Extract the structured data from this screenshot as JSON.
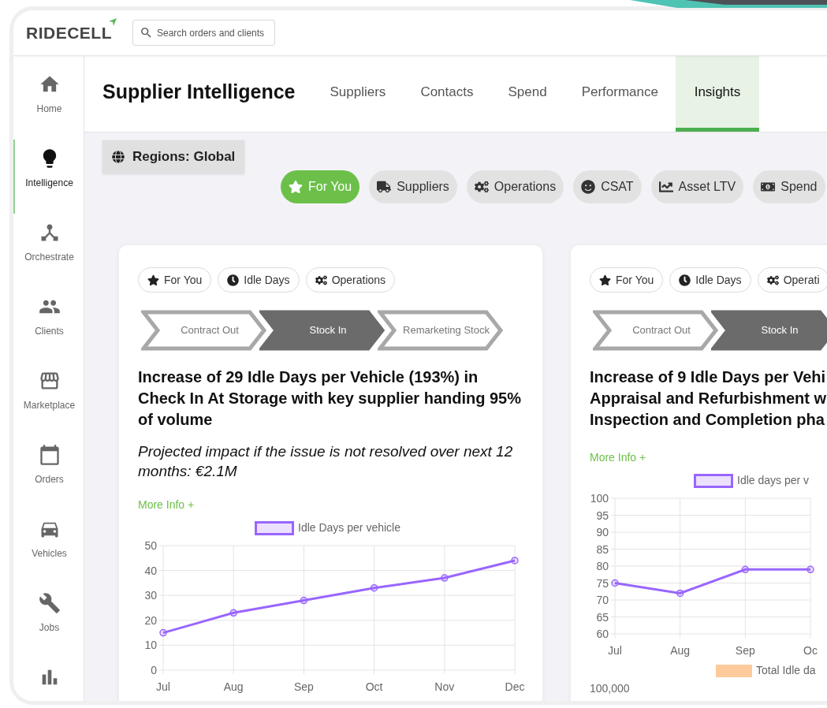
{
  "header": {
    "logo": "RIDECELL",
    "search": {
      "placeholder": "Search orders and clients"
    }
  },
  "sidebar": {
    "items": [
      {
        "label": "Home",
        "selected": false
      },
      {
        "label": "Intelligence",
        "selected": true
      },
      {
        "label": "Orchestrate",
        "selected": false
      },
      {
        "label": "Clients",
        "selected": false
      },
      {
        "label": "Marketplace",
        "selected": false
      },
      {
        "label": "Orders",
        "selected": false
      },
      {
        "label": "Vehicles",
        "selected": false
      },
      {
        "label": "Jobs",
        "selected": false
      },
      {
        "selected": false
      }
    ]
  },
  "page": {
    "title": "Supplier Intelligence",
    "tabs": [
      {
        "label": "Suppliers",
        "selected": false
      },
      {
        "label": "Contacts",
        "selected": false
      },
      {
        "label": "Spend",
        "selected": false
      },
      {
        "label": "Performance",
        "selected": false
      },
      {
        "label": "Insights",
        "selected": true
      }
    ]
  },
  "region_button": "Regions: Global",
  "filters": [
    {
      "label": "For You",
      "selected": true
    },
    {
      "label": "Suppliers",
      "selected": false
    },
    {
      "label": "Operations",
      "selected": false
    },
    {
      "label": "CSAT",
      "selected": false
    },
    {
      "label": "Asset LTV",
      "selected": false
    },
    {
      "label": "Spend",
      "selected": false
    }
  ],
  "cards": [
    {
      "tags": [
        "For You",
        "Idle Days",
        "Operations"
      ],
      "steps": [
        {
          "label": "Contract Out",
          "selected": false
        },
        {
          "label": "Stock In",
          "selected": true
        },
        {
          "label": "Remarketing Stock",
          "selected": false
        }
      ],
      "title_lines": [
        "Increase of 29 Idle Days per Vehicle (193%) in Check In At Storage with key supplier handing 95% of volume"
      ],
      "impact": "Projected impact if the issue is not resolved over next 12 months: €2.1M",
      "more_info": "More Info +",
      "chart_data": {
        "type": "line",
        "grid": true,
        "categories": [
          "Jul",
          "Aug",
          "Sep",
          "Oct",
          "Nov",
          "Dec"
        ],
        "ylim": [
          0,
          50
        ],
        "yticks": [
          0,
          10,
          20,
          30,
          40,
          50
        ],
        "series": [
          {
            "name": "Idle Days per vehicle",
            "color": "#9966ff",
            "marker": true,
            "values": [
              15,
              23,
              28,
              33,
              37,
              44
            ]
          }
        ]
      }
    },
    {
      "tags": [
        "For You",
        "Idle Days",
        "Operati"
      ],
      "steps": [
        {
          "label": "Contract Out",
          "selected": false
        },
        {
          "label": "Stock In",
          "selected": true
        }
      ],
      "title_lines": [
        "Increase of 9 Idle Days per Vehi",
        "Appraisal and Refurbishment w",
        "Inspection and Completion pha"
      ],
      "more_info": "More Info +",
      "chart_data": {
        "type": "line",
        "grid": true,
        "categories": [
          "Jul",
          "Aug",
          "Sep",
          "Oc"
        ],
        "ylim": [
          60,
          100
        ],
        "yticks": [
          60,
          65,
          70,
          75,
          80,
          85,
          90,
          95,
          100
        ],
        "series": [
          {
            "name": "Idle days per v",
            "color": "#9966ff",
            "marker": true,
            "values": [
              75,
              72,
              79,
              79
            ]
          }
        ]
      },
      "second_chart": {
        "legend": "Total Idle da",
        "color": "#fdca9c",
        "ytick": "100,000"
      }
    }
  ]
}
